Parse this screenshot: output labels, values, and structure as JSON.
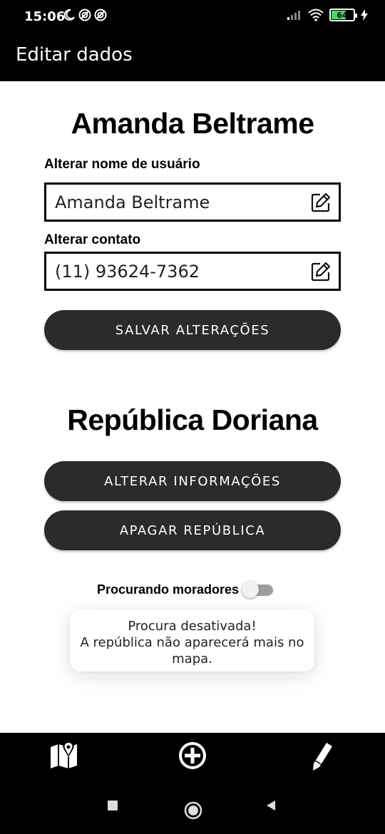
{
  "status_bar": {
    "time": "15:06",
    "battery_level": "64",
    "left_icons": [
      "moon-icon",
      "sync-icon",
      "sync-icon"
    ],
    "right_icons": [
      "signal-icon",
      "wifi-icon",
      "battery-icon",
      "charging-icon"
    ]
  },
  "app_bar": {
    "title": "Editar dados"
  },
  "profile": {
    "name": "Amanda Beltrame",
    "username_label": "Alterar nome de usuário",
    "username_value": "Amanda Beltrame",
    "contact_label": "Alterar contato",
    "contact_value": "(11) 93624-7362",
    "save_button": "SALVAR ALTERAÇÕES"
  },
  "republica": {
    "name": "República Doriana",
    "edit_button": "ALTERAR INFORMAÇÕES",
    "delete_button": "APAGAR REPÚBLICA",
    "toggle_label": "Procurando moradores",
    "toggle_on": false
  },
  "toast": {
    "line1": "Procura desativada!",
    "line2": "A república não aparecerá mais no mapa."
  },
  "bottom_nav": {
    "items": [
      "map-icon",
      "add-circle-icon",
      "pencil-icon"
    ]
  },
  "colors": {
    "button_bg": "#2b2b2b",
    "bar_bg": "#000000",
    "toggle_off": "#9e9e9e"
  }
}
